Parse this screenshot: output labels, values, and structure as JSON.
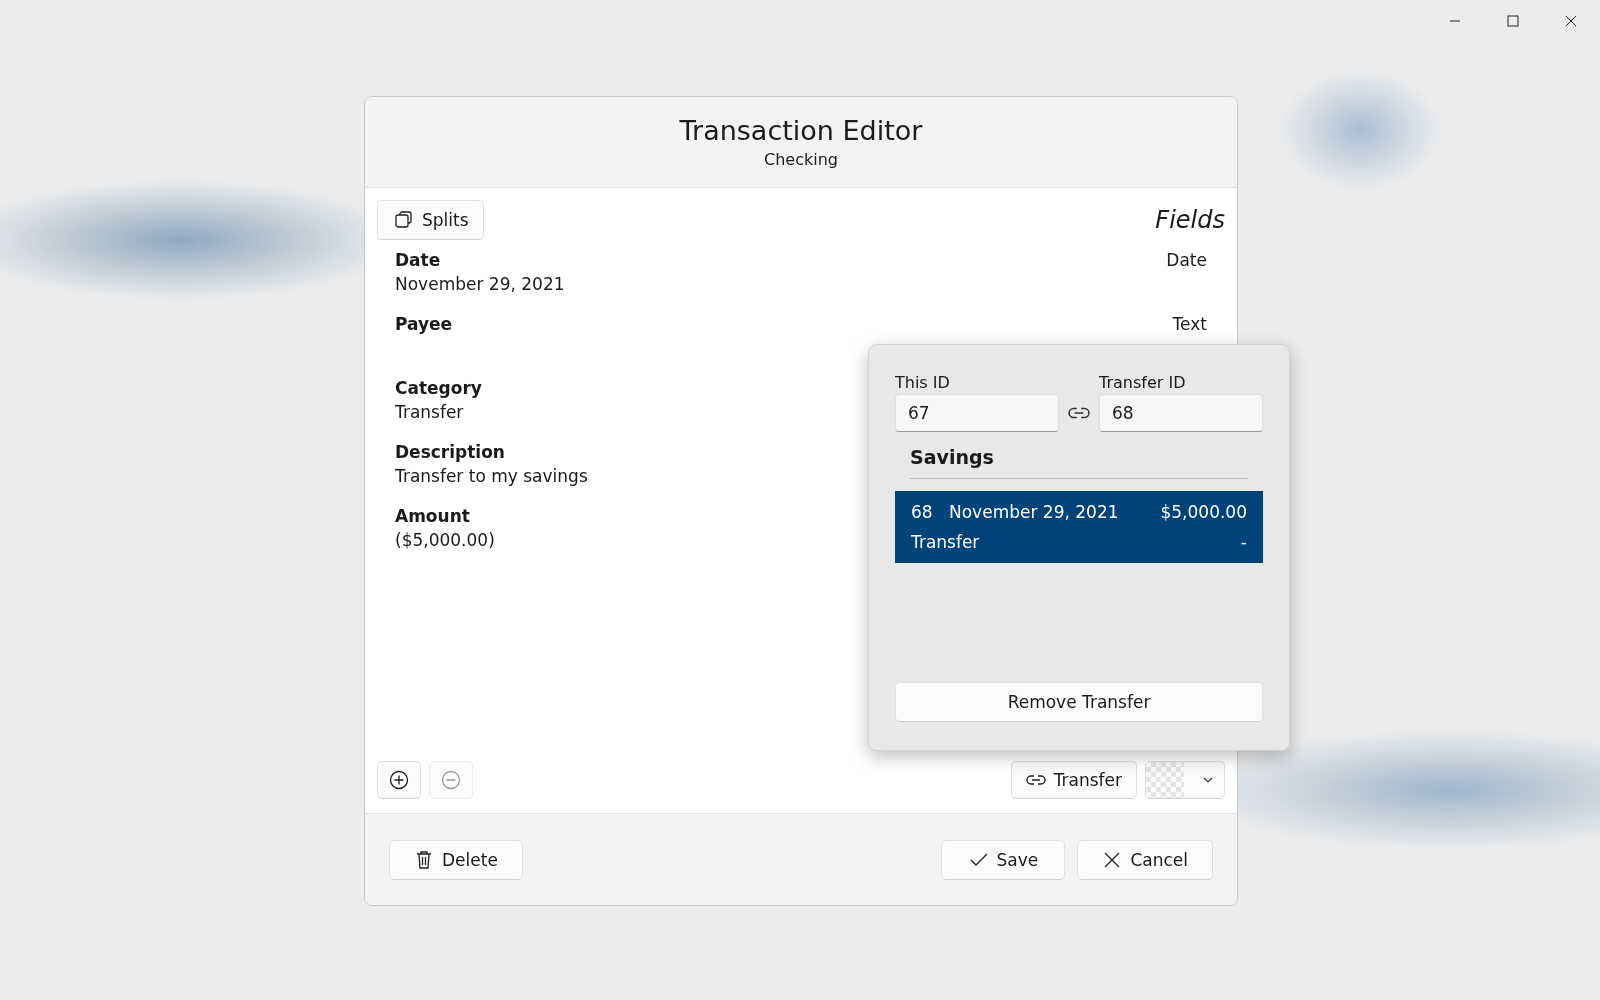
{
  "dialog": {
    "title": "Transaction Editor",
    "subtitle": "Checking",
    "splits_button": "Splits",
    "fields_heading": "Fields",
    "fields": [
      {
        "label": "Date",
        "value": "November 29, 2021",
        "type": "Date"
      },
      {
        "label": "Payee",
        "type": "Text"
      },
      {
        "label": "Category",
        "value": "Transfer"
      },
      {
        "label": "Description",
        "value": "Transfer to my savings"
      },
      {
        "label": "Amount",
        "value": "($5,000.00)"
      }
    ],
    "add_button": {
      "disabled": false
    },
    "remove_button": {
      "disabled": true
    },
    "transfer_button": "Transfer",
    "delete_button": "Delete",
    "save_button": "Save",
    "cancel_button": "Cancel"
  },
  "transfer_popup": {
    "this_id_label": "This ID",
    "this_id": "67",
    "transfer_id_label": "Transfer ID",
    "transfer_id": "68",
    "account": "Savings",
    "matches": [
      {
        "id": "68",
        "date": "November 29, 2021",
        "amount": "$5,000.00",
        "category": "Transfer",
        "note": "-",
        "selected": true
      }
    ],
    "remove_button": "Remove Transfer"
  }
}
